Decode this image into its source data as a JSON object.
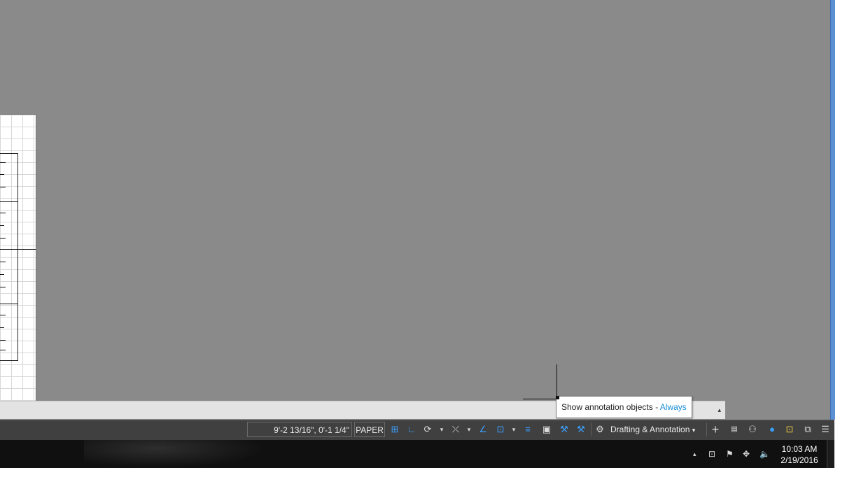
{
  "tooltip": {
    "prefix": "Show annotation objects - ",
    "value": "Always"
  },
  "statusbar": {
    "coordinates": "9'-2 13/16\", 0'-1 1/4\"",
    "space_label": "PAPER",
    "workspace_label": "Drafting & Annotation"
  },
  "icons": {
    "dropdown": "▾",
    "expand": "▴",
    "snap": "⊞",
    "ortho": "∟",
    "polar": "⟳",
    "osnap": "⤫",
    "angle": "∠",
    "dynamic": "⊡",
    "lineweight": "≡",
    "transparency": "▣",
    "annotation_visible": "⚒",
    "auto_scale": "⚒",
    "gear": "⚙",
    "plus": "+",
    "units": "▤",
    "isolate": "⚇",
    "hardware": "●",
    "clean_screen": "⧉",
    "customize": "☰",
    "tray_network": "⊡",
    "tray_flag": "⚑",
    "tray_dropbox": "✥",
    "tray_volume": "🔈"
  },
  "taskbar": {
    "time": "10:03 AM",
    "date": "2/19/2016"
  },
  "colors": {
    "canvas": "#8a8a8a",
    "statusbar": "#404040",
    "accent": "#3aa0ff",
    "highlight": "#1a8fd8"
  }
}
